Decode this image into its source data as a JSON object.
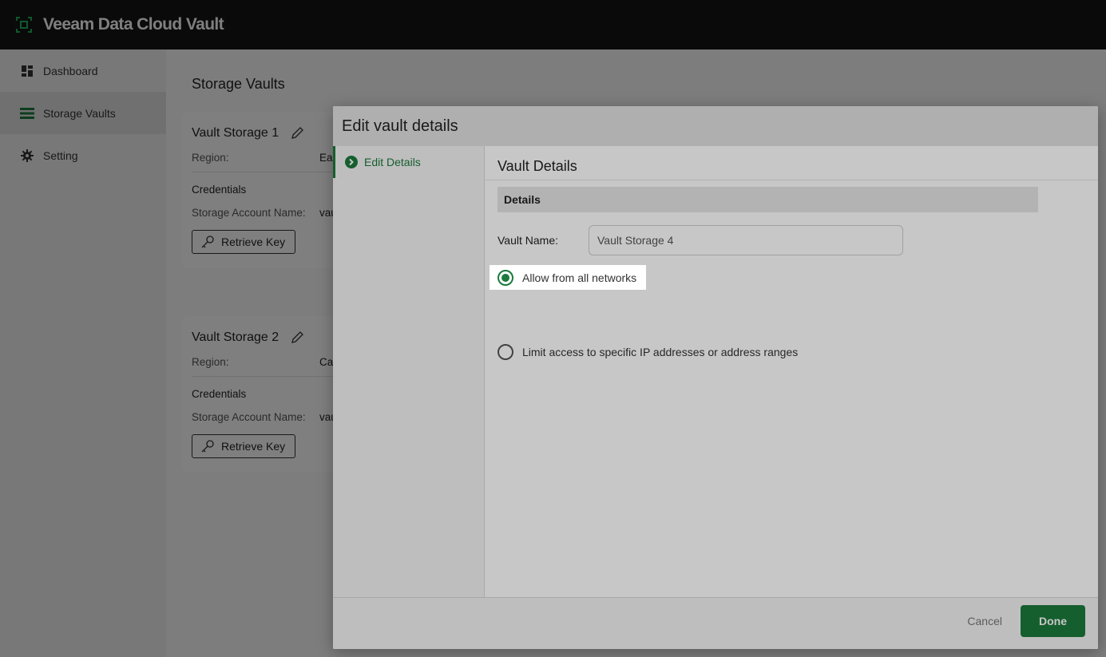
{
  "app": {
    "title": "Veeam Data Cloud Vault"
  },
  "sidebar": {
    "items": [
      {
        "label": "Dashboard",
        "icon": "dashboard-icon"
      },
      {
        "label": "Storage Vaults",
        "icon": "list-icon"
      },
      {
        "label": "Setting",
        "icon": "gear-icon"
      }
    ]
  },
  "main": {
    "title": "Storage Vaults",
    "vaults": [
      {
        "name": "Vault Storage 1",
        "region_label": "Region:",
        "region_value": "Ea",
        "credentials": "Credentials",
        "account_label": "Storage Account Name:",
        "account_value": "vau",
        "retrieve_label": "Retrieve Key"
      },
      {
        "name": "Vault Storage 2",
        "region_label": "Region:",
        "region_value": "Ca",
        "credentials": "Credentials",
        "account_label": "Storage Account Name:",
        "account_value": "vau",
        "retrieve_label": "Retrieve Key"
      }
    ]
  },
  "modal": {
    "title": "Edit vault details",
    "step": "Edit Details",
    "section_title": "Vault Details",
    "sub_header": "Details",
    "vault_name_label": "Vault Name:",
    "vault_name_value": "Vault Storage 4",
    "radio_all": "Allow from all networks",
    "radio_limit": "Limit access to specific IP addresses or address ranges",
    "cancel": "Cancel",
    "done": "Done"
  },
  "colors": {
    "accent": "#1b7a3c",
    "topbar": "#141414"
  }
}
